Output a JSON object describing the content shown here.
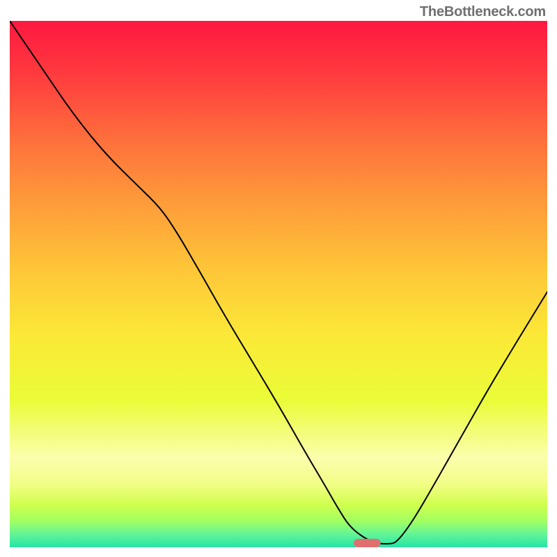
{
  "watermark": "TheBottleneck.com",
  "chart_data": {
    "type": "line",
    "title": "",
    "xlabel": "",
    "ylabel": "",
    "xlim": [
      0,
      100
    ],
    "ylim": [
      0,
      100
    ],
    "grid": false,
    "legend": false,
    "background_gradient": {
      "type": "vertical",
      "stops": [
        {
          "offset": 0.0,
          "color": "#fe1841"
        },
        {
          "offset": 0.1,
          "color": "#ff3a3e"
        },
        {
          "offset": 0.22,
          "color": "#fe6d3c"
        },
        {
          "offset": 0.35,
          "color": "#fe9d3a"
        },
        {
          "offset": 0.48,
          "color": "#fec838"
        },
        {
          "offset": 0.6,
          "color": "#fbe937"
        },
        {
          "offset": 0.72,
          "color": "#eafc37"
        },
        {
          "offset": 0.83,
          "color": "#fbfead"
        },
        {
          "offset": 0.88,
          "color": "#f2fe85"
        },
        {
          "offset": 0.92,
          "color": "#cfff4e"
        },
        {
          "offset": 0.95,
          "color": "#a2ff61"
        },
        {
          "offset": 0.975,
          "color": "#62f597"
        },
        {
          "offset": 1.0,
          "color": "#25e4a6"
        }
      ]
    },
    "series": [
      {
        "name": "bottleneck-curve",
        "style": "line",
        "color": "#000000",
        "width": 2,
        "x": [
          0.0,
          6.0,
          12.0,
          18.0,
          24.0,
          28.0,
          31.0,
          35.0,
          40.0,
          45.0,
          50.0,
          55.0,
          58.5,
          61.0,
          63.5,
          67.5,
          70.5,
          72.0,
          75.0,
          79.0,
          84.0,
          89.0,
          94.0,
          100.0
        ],
        "y": [
          100.0,
          91.0,
          82.0,
          74.5,
          68.5,
          64.5,
          60.0,
          53.0,
          44.0,
          35.5,
          27.0,
          18.0,
          12.0,
          7.5,
          3.5,
          0.8,
          0.6,
          0.9,
          5.0,
          12.0,
          21.0,
          30.0,
          38.5,
          48.5
        ]
      }
    ],
    "marker": {
      "name": "optimal-point",
      "shape": "pill",
      "color": "#e07070",
      "cx": 66.5,
      "cy": 0.8,
      "width": 5.0,
      "height": 1.6
    }
  }
}
